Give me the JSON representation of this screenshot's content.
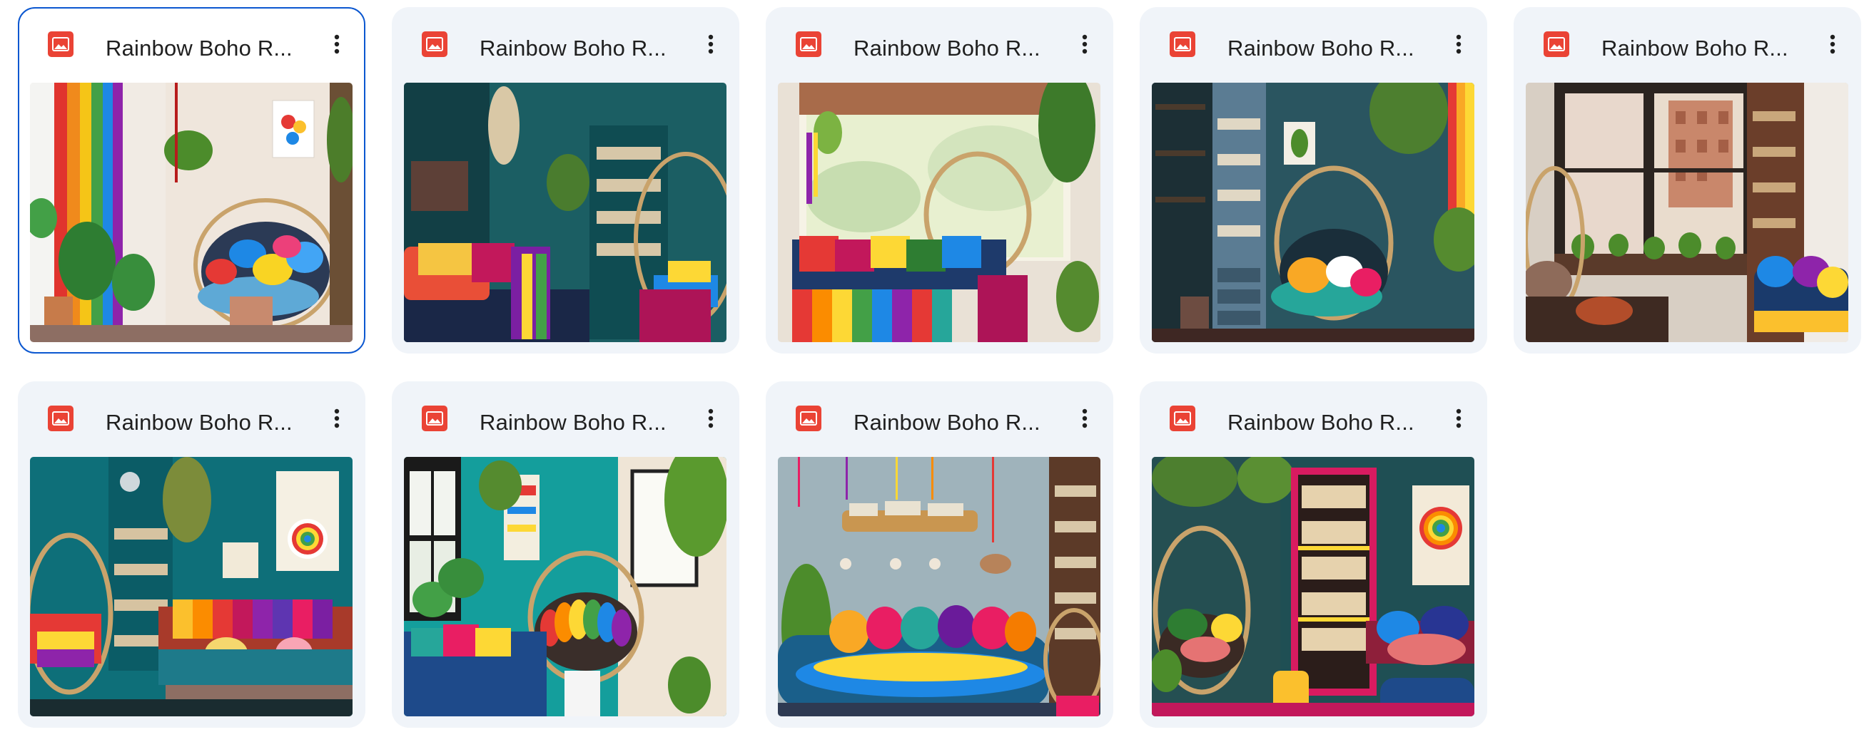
{
  "files": [
    {
      "title": "Rainbow Boho R...",
      "icon": "image-file-icon",
      "selected": true
    },
    {
      "title": "Rainbow Boho R...",
      "icon": "image-file-icon",
      "selected": false
    },
    {
      "title": "Rainbow Boho R...",
      "icon": "image-file-icon",
      "selected": false
    },
    {
      "title": "Rainbow Boho R...",
      "icon": "image-file-icon",
      "selected": false
    },
    {
      "title": "Rainbow Boho R...",
      "icon": "image-file-icon",
      "selected": false
    },
    {
      "title": "Rainbow Boho R...",
      "icon": "image-file-icon",
      "selected": false
    },
    {
      "title": "Rainbow Boho R...",
      "icon": "image-file-icon",
      "selected": false
    },
    {
      "title": "Rainbow Boho R...",
      "icon": "image-file-icon",
      "selected": false
    },
    {
      "title": "Rainbow Boho R...",
      "icon": "image-file-icon",
      "selected": false
    }
  ],
  "colors": {
    "card_bg": "#f0f4f9",
    "selected_border": "#0b57d0",
    "file_icon": "#ea4335",
    "text": "#1f1f1f"
  }
}
